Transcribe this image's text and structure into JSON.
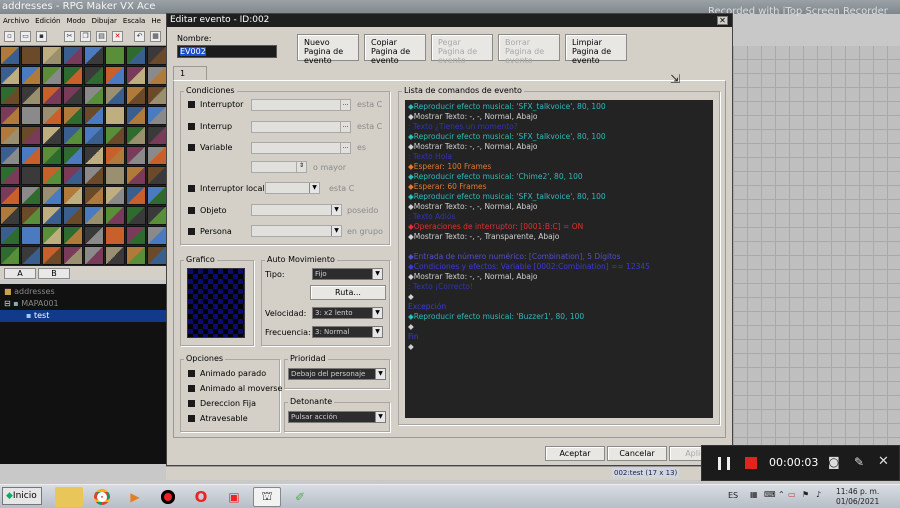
{
  "app": {
    "title": "addresses - RPG Maker VX Ace",
    "menu": [
      "Archivo",
      "Edición",
      "Modo",
      "Dibujar",
      "Escala",
      "He"
    ],
    "tab_a": "A",
    "tab_b": "B",
    "tree": [
      "addresses",
      "MAPA001",
      "test"
    ],
    "status": "002:test (17 x 13)",
    "watermark": "Recorded with iTop Screen Recorder"
  },
  "dialog": {
    "title": "Editar evento - ID:002",
    "close": "✕",
    "name_label": "Nombre:",
    "name_value": "EV002",
    "buttons": {
      "new": [
        "Nuevo",
        "Pagina de",
        "evento"
      ],
      "copy": [
        "Copiar",
        "Pagina de",
        "evento"
      ],
      "paste": [
        "Pegar",
        "Pagina de",
        "evento"
      ],
      "delete": [
        "Borrar",
        "Pagina de",
        "evento"
      ],
      "clear": [
        "Limpiar",
        "Pagina de",
        "evento"
      ]
    },
    "page_tab": "1",
    "conditions": {
      "title": "Condiciones",
      "switch1": "Interruptor",
      "switch1_suffix": "esta C",
      "switch2": "Interrup",
      "switch2_suffix": "esta C",
      "variable": "Variable",
      "variable_suffix": "es",
      "variable_more": "o mayor",
      "self_switch": "Interruptor local",
      "self_switch_suffix": "esta C",
      "item": "Objeto",
      "item_suffix": "poseido",
      "actor": "Persona",
      "actor_suffix": "en grupo"
    },
    "graphic_title": "Grafico",
    "automove": {
      "title": "Auto Movimiento",
      "type_label": "Tipo:",
      "type_value": "Fijo",
      "route_btn": "Ruta...",
      "speed_label": "Velocidad:",
      "speed_value": "3: x2 lento",
      "freq_label": "Frecuencia:",
      "freq_value": "3: Normal"
    },
    "options": {
      "title": "Opciones",
      "walk": "Animado parado",
      "step": "Animado al moverse",
      "dirfix": "Dereccion Fija",
      "through": "Atravesable"
    },
    "priority": {
      "title": "Prioridad",
      "value": "Debajo del personaje"
    },
    "trigger": {
      "title": "Detonante",
      "value": "Pulsar acción"
    },
    "list_title": "Lista de comandos de evento",
    "commands": [
      {
        "text": "◆Reproducir efecto musical: 'SFX_talkvoice', 80, 100",
        "color": "#32b8b8"
      },
      {
        "text": "◆Mostrar Texto: -, -, Normal, Abajo",
        "color": "#d0d0d0"
      },
      {
        "text": ": Texto ¿Tienes un momento?",
        "color": "#3232b8"
      },
      {
        "text": "◆Reproducir efecto musical: 'SFX_talkvoice', 80, 100",
        "color": "#32b8b8"
      },
      {
        "text": "◆Mostrar Texto: -, -, Normal, Abajo",
        "color": "#d0d0d0"
      },
      {
        "text": ": Texto Hola",
        "color": "#3232b8"
      },
      {
        "text": "◆Esperar: 100 Frames",
        "color": "#e07a30"
      },
      {
        "text": "◆Reproducir efecto musical: 'Chime2', 80, 100",
        "color": "#32b8b8"
      },
      {
        "text": "◆Esperar: 60 Frames",
        "color": "#e07a30"
      },
      {
        "text": "◆Reproducir efecto musical: 'SFX_talkvoice', 80, 100",
        "color": "#32b8b8"
      },
      {
        "text": "◆Mostrar Texto: -, -, Normal, Abajo",
        "color": "#d0d0d0"
      },
      {
        "text": ": Texto Adiós",
        "color": "#3232b8"
      },
      {
        "text": "◆Operaciones de interruptor: [0001:B:C] = ON",
        "color": "#e03030"
      },
      {
        "text": "◆Mostrar Texto: -, -, Transparente, Abajo",
        "color": "#d0d0d0"
      },
      {
        "text": "",
        "color": "#d0d0d0"
      },
      {
        "text": "◆Entrada de número numérico: [Combination], 5 Dígitos",
        "color": "#5050c8"
      },
      {
        "text": "◆Condiciones y efectos: Variable [0002:Combination] == 12345",
        "color": "#3a3ad8"
      },
      {
        "text": "◆Mostrar Texto: -, -, Normal, Abajo",
        "color": "#d0d0d0"
      },
      {
        "text": ": Texto ¡Correcto!",
        "color": "#3232b8"
      },
      {
        "text": "◆",
        "color": "#d0d0d0"
      },
      {
        "text": "Excepción",
        "color": "#3a3ad8"
      },
      {
        "text": "◆Reproducir efecto musical: 'Buzzer1', 80, 100",
        "color": "#32b8b8"
      },
      {
        "text": "◆",
        "color": "#d0d0d0"
      },
      {
        "text": "Fin",
        "color": "#3a3ad8"
      },
      {
        "text": "◆",
        "color": "#d0d0d0"
      }
    ],
    "ok": "Aceptar",
    "cancel": "Cancelar",
    "apply": "Aplicar"
  },
  "recorder": {
    "time": "00:00:03"
  },
  "taskbar": {
    "start": "Inicio",
    "lang": "ES",
    "time": "11:46 p. m.",
    "date": "01/06/2021"
  }
}
